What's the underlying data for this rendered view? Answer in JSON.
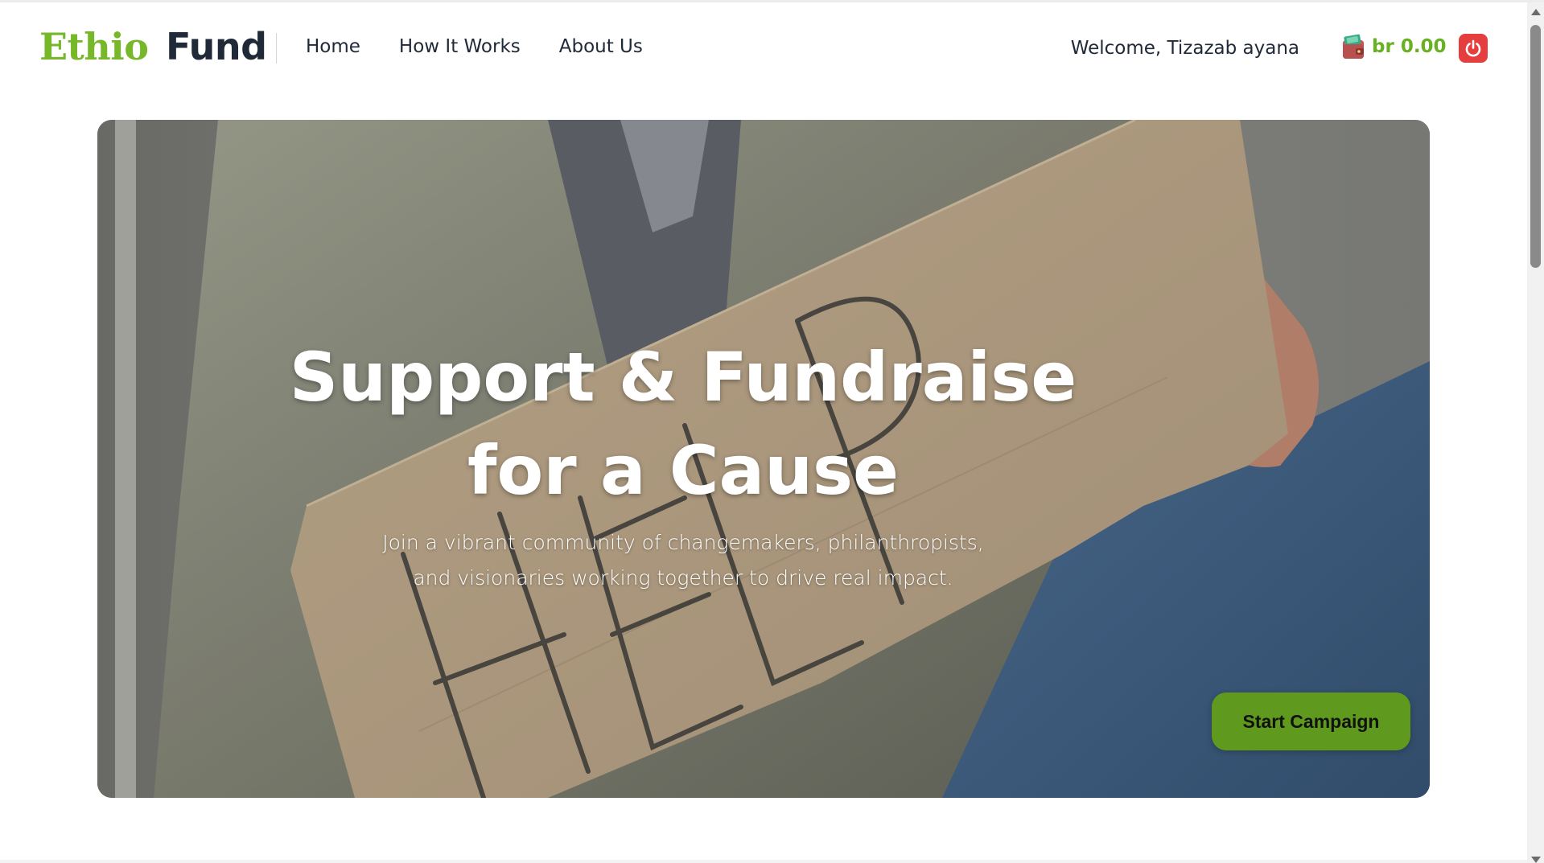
{
  "brand": {
    "part1": "Ethio",
    "part2": "Fund",
    "colors": {
      "part1": "#76b82a",
      "part2": "#1f2937"
    }
  },
  "nav": {
    "links": [
      {
        "label": "Home"
      },
      {
        "label": "How It Works"
      },
      {
        "label": "About Us"
      }
    ]
  },
  "user": {
    "welcome": "Welcome, Tizazab ayana",
    "wallet_balance": "br 0.00",
    "wallet_icon": "wallet-icon",
    "logout_icon": "power-icon"
  },
  "hero": {
    "title": "Support & Fundraise for a Cause",
    "subtitle": "Join a vibrant community of changemakers, philanthropists, and visionaries working together to drive real impact.",
    "cta_label": "Start Campaign",
    "image_subject": "Person holding a cardboard HELP sign",
    "sign_text": "HELP"
  },
  "theme": {
    "accent": "#6ab023",
    "cta_bg": "#5f9a1f",
    "logout_bg": "#e53e3e"
  }
}
